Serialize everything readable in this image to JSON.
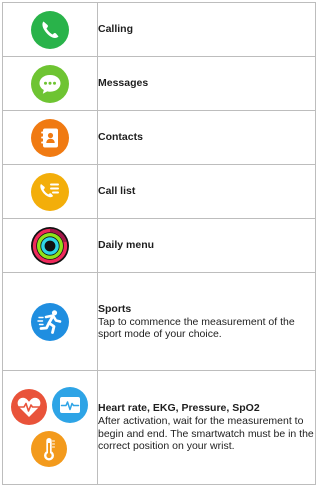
{
  "rows": [
    {
      "title": "Calling",
      "icon": "phone-icon"
    },
    {
      "title": "Messages",
      "icon": "messages-icon"
    },
    {
      "title": "Contacts",
      "icon": "contacts-icon"
    },
    {
      "title": "Call list",
      "icon": "call-list-icon"
    },
    {
      "title": "Daily menu",
      "icon": "activity-rings-icon"
    },
    {
      "title": "Sports",
      "description": "Tap to commence the measurement of the sport mode of your choice.",
      "icon": "running-icon"
    },
    {
      "title": "Heart rate, EKG, Pressure, SpO2",
      "description": "After activation, wait for the measurement to begin and end. The smartwatch must be in the correct position on your wrist.",
      "icons": [
        "heart-rate-icon",
        "ekg-icon",
        "thermometer-icon"
      ]
    }
  ],
  "colors": {
    "phone": "#29b34a",
    "messages": "#6ec432",
    "contacts": "#f07a12",
    "call_list": "#f3ae0a",
    "sports": "#1f8ee0",
    "heart_rate": "#e9533a",
    "ekg": "#2ea4e6",
    "thermometer": "#f39a1c",
    "table_border": "#bdbdbd"
  }
}
